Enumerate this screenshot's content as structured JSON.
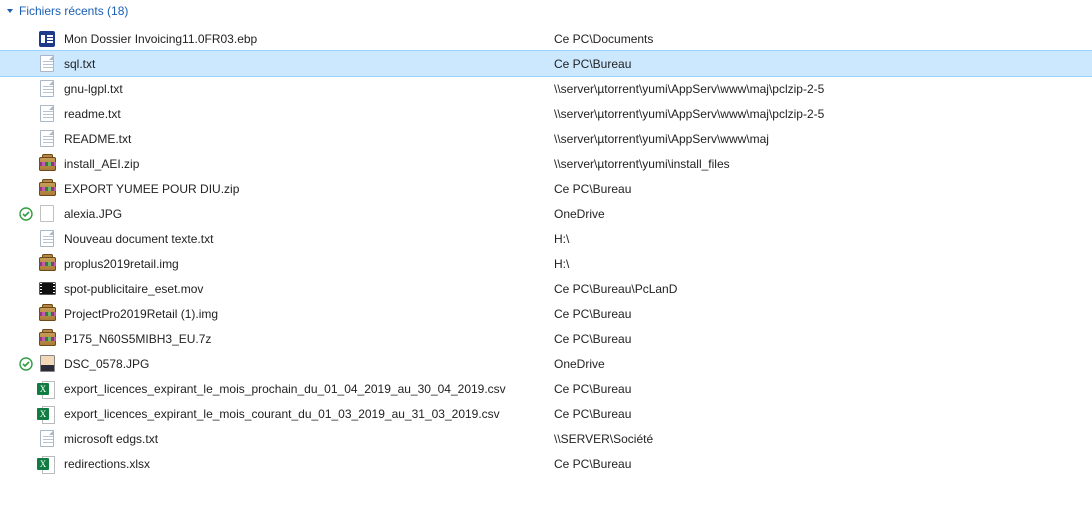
{
  "group": {
    "label": "Fichiers récents",
    "count": 18
  },
  "files": [
    {
      "icon": "ebp",
      "sync": "",
      "name": "Mon Dossier Invoicing11.0FR03.ebp",
      "path": "Ce PC\\Documents",
      "selected": false
    },
    {
      "icon": "txt",
      "sync": "",
      "name": "sql.txt",
      "path": "Ce PC\\Bureau",
      "selected": true
    },
    {
      "icon": "txt",
      "sync": "",
      "name": "gnu-lgpl.txt",
      "path": "\\\\server\\µtorrent\\yumi\\AppServ\\www\\maj\\pclzip-2-5",
      "selected": false
    },
    {
      "icon": "txt",
      "sync": "",
      "name": "readme.txt",
      "path": "\\\\server\\µtorrent\\yumi\\AppServ\\www\\maj\\pclzip-2-5",
      "selected": false
    },
    {
      "icon": "txt",
      "sync": "",
      "name": "README.txt",
      "path": "\\\\server\\µtorrent\\yumi\\AppServ\\www\\maj",
      "selected": false
    },
    {
      "icon": "zip",
      "sync": "",
      "name": "install_AEI.zip",
      "path": "\\\\server\\µtorrent\\yumi\\install_files",
      "selected": false
    },
    {
      "icon": "zip",
      "sync": "",
      "name": "EXPORT YUMEE POUR DIU.zip",
      "path": "Ce PC\\Bureau",
      "selected": false
    },
    {
      "icon": "blank",
      "sync": "green",
      "name": "alexia.JPG",
      "path": "OneDrive",
      "selected": false
    },
    {
      "icon": "txt",
      "sync": "",
      "name": "Nouveau document texte.txt",
      "path": "H:\\",
      "selected": false
    },
    {
      "icon": "zip",
      "sync": "",
      "name": "proplus2019retail.img",
      "path": "H:\\",
      "selected": false
    },
    {
      "icon": "vid",
      "sync": "",
      "name": "spot-publicitaire_eset.mov",
      "path": "Ce PC\\Bureau\\PcLanD",
      "selected": false
    },
    {
      "icon": "zip",
      "sync": "",
      "name": "ProjectPro2019Retail (1).img",
      "path": "Ce PC\\Bureau",
      "selected": false
    },
    {
      "icon": "zip",
      "sync": "",
      "name": "P175_N60S5MIBH3_EU.7z",
      "path": "Ce PC\\Bureau",
      "selected": false
    },
    {
      "icon": "pic",
      "sync": "green",
      "name": "DSC_0578.JPG",
      "path": "OneDrive",
      "selected": false
    },
    {
      "icon": "csv",
      "sync": "",
      "name": "export_licences_expirant_le_mois_prochain_du_01_04_2019_au_30_04_2019.csv",
      "path": "Ce PC\\Bureau",
      "selected": false
    },
    {
      "icon": "csv",
      "sync": "",
      "name": "export_licences_expirant_le_mois_courant_du_01_03_2019_au_31_03_2019.csv",
      "path": "Ce PC\\Bureau",
      "selected": false
    },
    {
      "icon": "txt",
      "sync": "",
      "name": "microsoft edgs.txt",
      "path": "\\\\SERVER\\Société",
      "selected": false
    },
    {
      "icon": "xlsx",
      "sync": "",
      "name": "redirections.xlsx",
      "path": "Ce PC\\Bureau",
      "selected": false
    }
  ]
}
